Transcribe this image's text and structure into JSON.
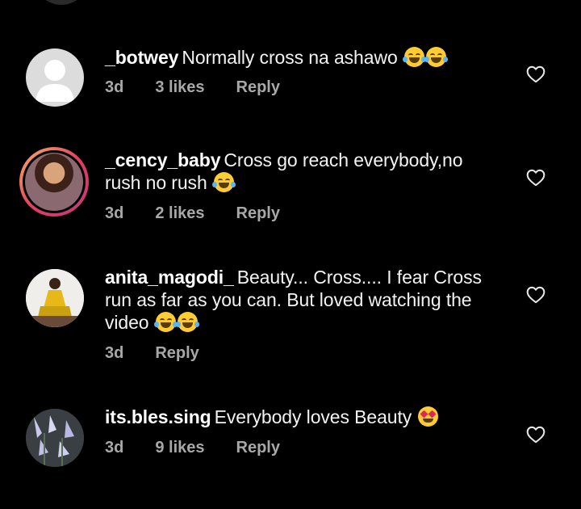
{
  "comments": [
    {
      "username": "_botwey",
      "text": "Normally cross na ashawo",
      "emojis": [
        "face-with-tears-of-joy",
        "face-with-tears-of-joy"
      ],
      "time": "3d",
      "likes": "3 likes",
      "reply": "Reply",
      "avatar": "default-avatar"
    },
    {
      "username": "_cency_baby",
      "text": "Cross go reach everybody,no rush no rush",
      "emojis": [
        "face-with-tears-of-joy"
      ],
      "time": "3d",
      "likes": "2 likes",
      "reply": "Reply",
      "avatar": "story-ring-avatar"
    },
    {
      "username": "anita_magodi_",
      "text": "Beauty... Cross.... I fear Cross run as far as you can. But loved watching the video",
      "emojis": [
        "face-with-tears-of-joy",
        "face-with-tears-of-joy"
      ],
      "time": "3d",
      "likes": "",
      "reply": "Reply",
      "avatar": "photo-avatar"
    },
    {
      "username": "its.bles.sing",
      "text": "Everybody loves Beauty",
      "emojis": [
        "smiling-face-with-heart-eyes"
      ],
      "time": "3d",
      "likes": "9 likes",
      "reply": "Reply",
      "avatar": "flowers-avatar"
    }
  ],
  "colors": {
    "background": "#000000",
    "text": "#f5f5f5",
    "meta": "#a8a8a8"
  }
}
